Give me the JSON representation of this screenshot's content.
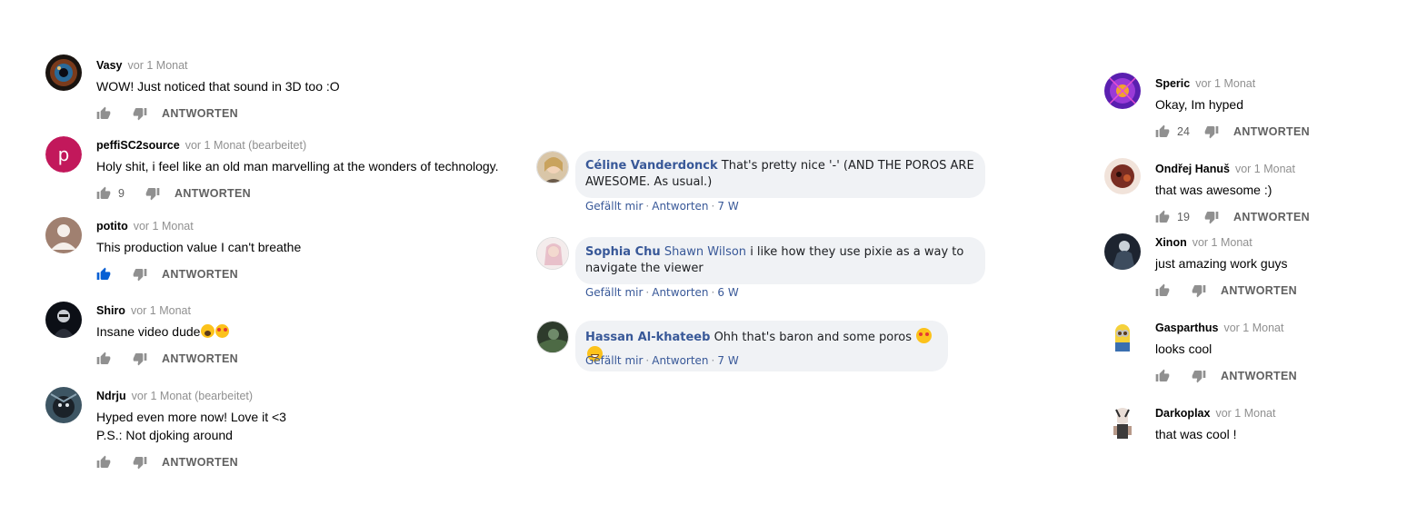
{
  "left_column": [
    {
      "author": "Vasy",
      "time": "vor 1 Monat",
      "text": "WOW! Just noticed that sound in 3D too :O",
      "likes": "",
      "reply": "ANTWORTEN"
    },
    {
      "author": "peffiSC2source",
      "time": "vor 1 Monat (bearbeitet)",
      "text": "Holy shit, i feel like an old man marvelling at the wonders of technology.",
      "likes": "9",
      "reply": "ANTWORTEN",
      "avatar_letter": "p"
    },
    {
      "author": "potito",
      "time": "vor 1 Monat",
      "text": "This production value I can't breathe",
      "likes": "",
      "reply": "ANTWORTEN",
      "liked": true
    },
    {
      "author": "Shiro",
      "time": "vor 1 Monat",
      "text": "Insane video dude",
      "likes": "",
      "reply": "ANTWORTEN"
    },
    {
      "author": "Ndrju",
      "time": "vor 1 Monat (bearbeitet)",
      "text": "Hyped even more now! Love it <3",
      "text2": "P.S.: Not djoking around",
      "likes": "",
      "reply": "ANTWORTEN"
    }
  ],
  "middle_column": [
    {
      "author": "Céline Vanderdonck",
      "text": "That's pretty nice '-' (AND THE POROS ARE",
      "text2": "AWESOME. As usual.)",
      "like": "Gefällt mir",
      "reply": "Antworten",
      "time": "7 W"
    },
    {
      "author": "Sophia Chu",
      "mention": "Shawn Wilson",
      "text": "i like how they use pixie as a way to",
      "text2": "navigate the viewer",
      "like": "Gefällt mir",
      "reply": "Antworten",
      "time": "6 W"
    },
    {
      "author": "Hassan Al-khateeb",
      "text": "Ohh that's baron and some poros",
      "like": "Gefällt mir",
      "reply": "Antworten",
      "time": "7 W"
    }
  ],
  "right_column": [
    {
      "author": "Speric",
      "time": "vor 1 Monat",
      "text": "Okay, Im hyped",
      "likes": "24",
      "reply": "ANTWORTEN"
    },
    {
      "author": "Ondřej Hanuš",
      "time": "vor 1 Monat",
      "text": "that was awesome :)",
      "likes": "19",
      "reply": "ANTWORTEN"
    },
    {
      "author": "Xinon",
      "time": "vor 1 Monat",
      "text": "just amazing work guys",
      "likes": "",
      "reply": "ANTWORTEN"
    },
    {
      "author": "Gasparthus",
      "time": "vor 1 Monat",
      "text": "looks cool",
      "likes": "",
      "reply": "ANTWORTEN"
    },
    {
      "author": "Darkoplax",
      "time": "vor 1 Monat",
      "text": "that was cool !",
      "likes": "",
      "reply": ""
    }
  ],
  "colors": {
    "like_active": "#065fd4",
    "icon": "#909090",
    "fb_link": "#385898",
    "fb_bubble": "#f0f2f5"
  }
}
